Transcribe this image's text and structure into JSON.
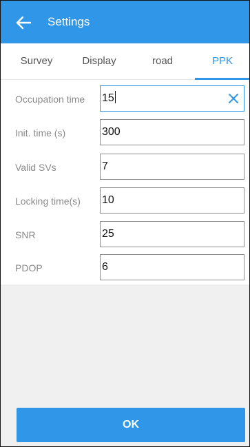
{
  "appbar": {
    "title": "Settings",
    "back_icon": "arrow-left-icon"
  },
  "tabs": [
    {
      "label": "Survey",
      "active": false
    },
    {
      "label": "Display",
      "active": false
    },
    {
      "label": "road",
      "active": false
    },
    {
      "label": "PPK",
      "active": true
    }
  ],
  "form": {
    "fields": [
      {
        "label": "Occupation time",
        "value": "15",
        "focused": true
      },
      {
        "label": "Init. time (s)",
        "value": "300"
      },
      {
        "label": "Valid SVs",
        "value": "7"
      },
      {
        "label": "Locking time(s)",
        "value": "10"
      },
      {
        "label": "SNR",
        "value": "25"
      },
      {
        "label": "PDOP",
        "value": "6"
      }
    ],
    "clear_icon": "close-icon"
  },
  "ok_label": "OK",
  "colors": {
    "accent": "#2f96e8",
    "background": "#f0f0f0",
    "label_text": "#8a8a8a"
  }
}
